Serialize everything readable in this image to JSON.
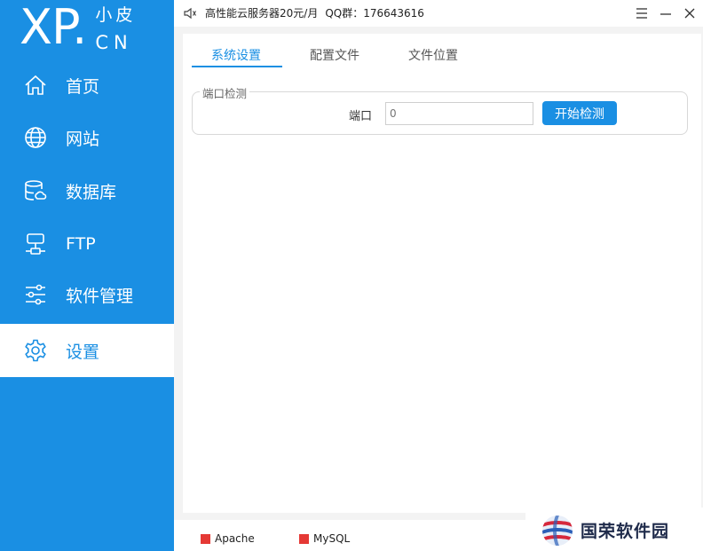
{
  "logo": {
    "brand": "XP",
    "dot": ".",
    "name": "小皮",
    "domain": "CN"
  },
  "sidebar": {
    "items": [
      {
        "label": "首页",
        "icon": "home-icon"
      },
      {
        "label": "网站",
        "icon": "globe-icon"
      },
      {
        "label": "数据库",
        "icon": "database-icon"
      },
      {
        "label": "FTP",
        "icon": "ftp-icon"
      },
      {
        "label": "软件管理",
        "icon": "sliders-icon"
      },
      {
        "label": "设置",
        "icon": "gear-icon",
        "active": true
      }
    ]
  },
  "titlebar": {
    "ad": "高性能云服务器20元/月",
    "qq": "QQ群：176643616"
  },
  "tabs": [
    {
      "label": "系统设置",
      "active": true
    },
    {
      "label": "配置文件"
    },
    {
      "label": "文件位置"
    }
  ],
  "port_check": {
    "legend": "端口检测",
    "label": "端口",
    "placeholder": "0",
    "button": "开始检测"
  },
  "status": {
    "services": [
      {
        "name": "Apache",
        "color": "#e53935"
      },
      {
        "name": "MySQL",
        "color": "#e53935"
      }
    ]
  },
  "watermark": {
    "text": "国荣软件园"
  },
  "colors": {
    "accent": "#1a8fe3",
    "stopped": "#e53935"
  }
}
